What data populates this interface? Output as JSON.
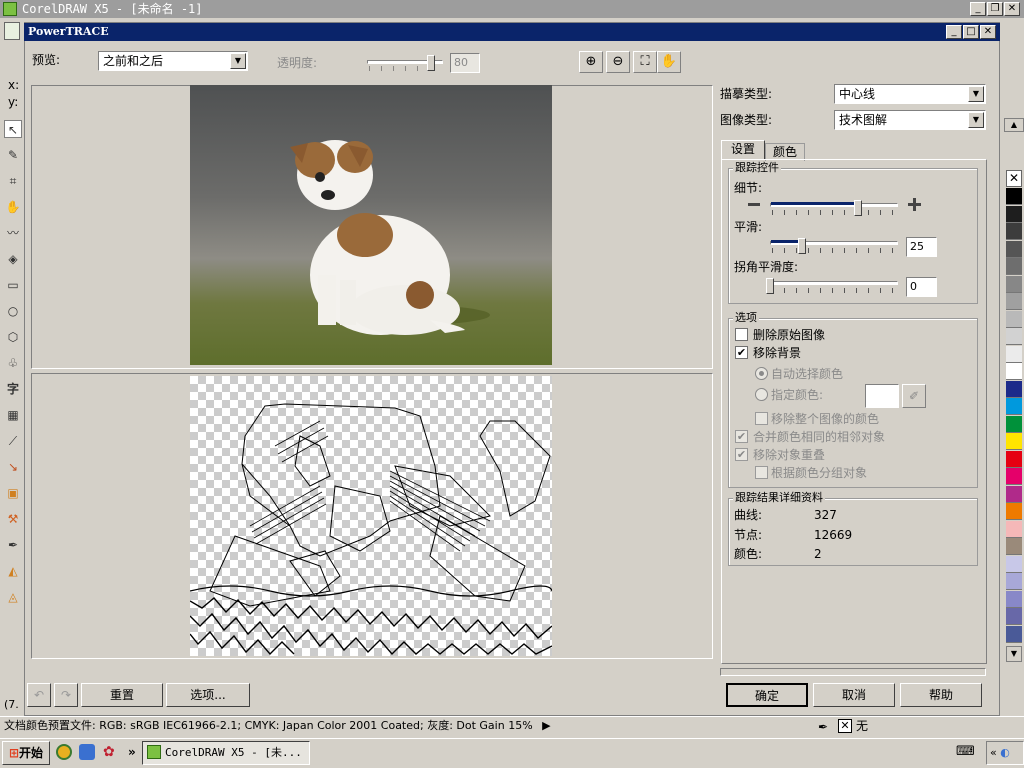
{
  "app": {
    "title": "CorelDRAW X5 - [未命名 -1]"
  },
  "dialog": {
    "title": "PowerTRACE"
  },
  "preview": {
    "label": "预览:",
    "mode": "之前和之后",
    "transparency_label": "透明度:",
    "transparency_value": "80"
  },
  "left": {
    "x_label": "x:",
    "y_label": "y:",
    "zoom_fragment": "(7."
  },
  "panel": {
    "trace_type_label": "描摹类型:",
    "trace_type": "中心线",
    "image_type_label": "图像类型:",
    "image_type": "技术图解",
    "tabs": [
      "设置",
      "颜色"
    ],
    "tracking": {
      "title": "跟踪控件",
      "detail_label": "细节:",
      "detail_level": 0.7,
      "smooth_label": "平滑:",
      "smooth_value": "25",
      "corner_label": "拐角平滑度:",
      "corner_value": "0"
    },
    "options": {
      "title": "选项",
      "delete_original": "删除原始图像",
      "remove_background": "移除背景",
      "auto_color": "自动选择颜色",
      "specify_color": "指定颜色:",
      "remove_whole_color": "移除整个图像的颜色",
      "merge_adjacent": "合并颜色相同的相邻对象",
      "remove_overlap": "移除对象重叠",
      "group_by_color": "根据颜色分组对象"
    },
    "results": {
      "title": "跟踪结果详细资料",
      "curves_label": "曲线:",
      "curves": "327",
      "nodes_label": "节点:",
      "nodes": "12669",
      "colors_label": "颜色:",
      "colors": "2"
    }
  },
  "buttons": {
    "reset": "重置",
    "options": "选项...",
    "ok": "确定",
    "cancel": "取消",
    "help": "帮助"
  },
  "status": {
    "text": "文档颜色预置文件: RGB: sRGB IEC61966-2.1; CMYK: Japan Color 2001 Coated; 灰度: Dot Gain 15%",
    "fill_label": "无"
  },
  "taskbar": {
    "start": "开始",
    "task": "CorelDRAW X5 - [未..."
  },
  "palette_colors": [
    "#000000",
    "#1e1e1e",
    "#3c3c3c",
    "#555555",
    "#6e6e6e",
    "#878787",
    "#a0a0a0",
    "#b9b9b9",
    "#d2d2d2",
    "#ebebeb",
    "#ffffff",
    "#1c2a8a",
    "#0099dd",
    "#00913a",
    "#ffe500",
    "#e60012",
    "#e5006a",
    "#b02a8a",
    "#ef7a00",
    "#f5b8b8",
    "#9a8a7a",
    "#c8c8e8",
    "#a8a8d8",
    "#8888c8",
    "#6868a8",
    "#4a5a98"
  ]
}
